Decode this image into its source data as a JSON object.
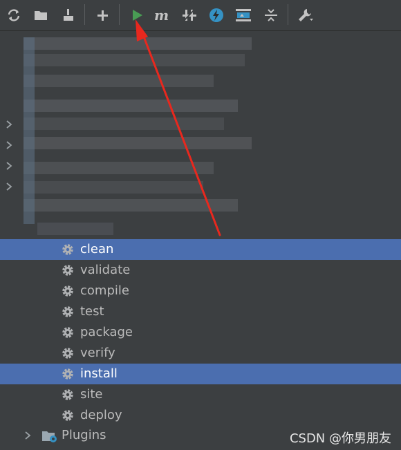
{
  "toolbar": {
    "buttons": [
      {
        "name": "refresh-icon",
        "color": "#c3c3c3"
      },
      {
        "name": "folder-icon",
        "color": "#c3c3c3"
      },
      {
        "name": "download-icon",
        "color": "#c3c3c3"
      },
      {
        "name": "add-icon",
        "color": "#c3c3c3"
      },
      {
        "name": "run-icon",
        "color": "#499c54"
      },
      {
        "name": "maven-goal-icon",
        "color": "#c3c3c3"
      },
      {
        "name": "toggle-offline-icon",
        "color": "#c3c3c3"
      },
      {
        "name": "skip-tests-icon",
        "color": "#3592c4"
      },
      {
        "name": "show-dependencies-icon",
        "color": "#3592c4"
      },
      {
        "name": "collapse-all-icon",
        "color": "#c3c3c3"
      },
      {
        "name": "settings-wrench-icon",
        "color": "#c3c3c3"
      }
    ]
  },
  "lifecycle": {
    "items": [
      {
        "label": "clean",
        "selected": true
      },
      {
        "label": "validate",
        "selected": false
      },
      {
        "label": "compile",
        "selected": false
      },
      {
        "label": "test",
        "selected": false
      },
      {
        "label": "package",
        "selected": false
      },
      {
        "label": "verify",
        "selected": false
      },
      {
        "label": "install",
        "selected": true
      },
      {
        "label": "site",
        "selected": false
      },
      {
        "label": "deploy",
        "selected": false
      }
    ]
  },
  "plugins": {
    "label": "Plugins"
  },
  "watermark": "CSDN @你男朋友",
  "colors": {
    "background": "#3c3f41",
    "selection": "#4b6eaf",
    "annotation_arrow": "#e8281e"
  }
}
